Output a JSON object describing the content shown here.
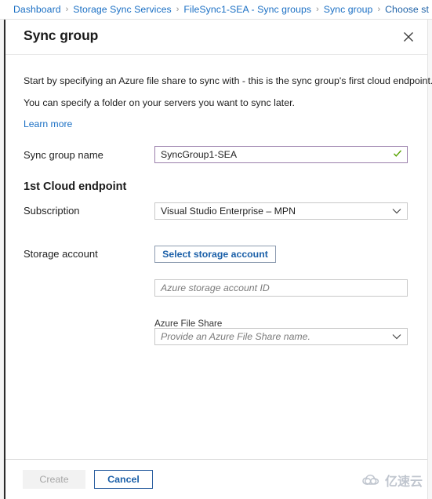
{
  "breadcrumb": {
    "items": [
      {
        "label": "Dashboard"
      },
      {
        "label": "Storage Sync Services"
      },
      {
        "label": "FileSync1-SEA - Sync groups"
      },
      {
        "label": "Sync group"
      },
      {
        "label": "Choose st"
      }
    ],
    "separator": "›"
  },
  "blade": {
    "title": "Sync group",
    "close_icon": "close-icon"
  },
  "intro": {
    "line1": "Start by specifying an Azure file share to sync with - this is the sync group's first cloud endpoint.",
    "line2": "You can specify a folder on your servers you want to sync later.",
    "learn_more": "Learn more"
  },
  "form": {
    "sync_group_name": {
      "label": "Sync group name",
      "value": "SyncGroup1-SEA",
      "placeholder": "",
      "valid_icon": "check-icon",
      "valid_color": "#57a300",
      "border_color": "#9a7fab"
    },
    "section_heading": "1st Cloud endpoint",
    "subscription": {
      "label": "Subscription",
      "value": "Visual Studio Enterprise – MPN",
      "chevron_icon": "chevron-down-icon"
    },
    "storage_account": {
      "label": "Storage account",
      "button_label": "Select storage account",
      "id_placeholder": "Azure storage account ID",
      "id_value": ""
    },
    "azure_file_share": {
      "label": "Azure File Share",
      "placeholder": "Provide an Azure File Share name.",
      "value": "",
      "chevron_icon": "chevron-down-icon"
    }
  },
  "footer": {
    "create_label": "Create",
    "cancel_label": "Cancel"
  },
  "watermark": {
    "text": "亿速云",
    "icon": "cloud-logo-icon"
  },
  "colors": {
    "link": "#1a6fc4",
    "accent": "#1a5fa8",
    "success": "#57a300",
    "field_border": "#c8c8c8"
  }
}
